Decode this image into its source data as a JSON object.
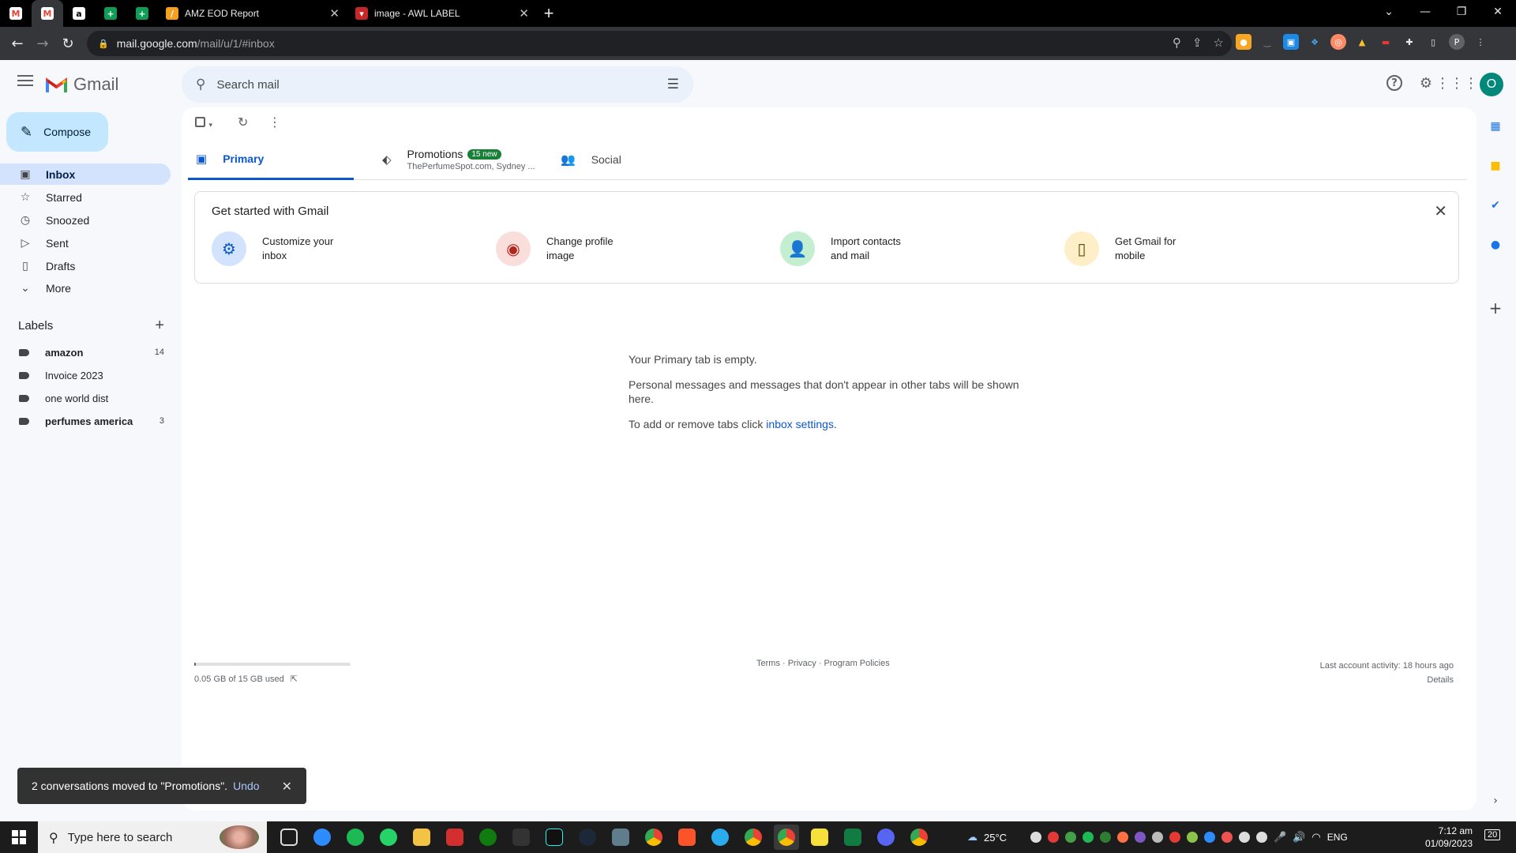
{
  "browser": {
    "tabs": [
      {
        "title": "AMZ EOD Report"
      },
      {
        "title": "image - AWL LABEL"
      }
    ],
    "url_host": "mail.google.com",
    "url_path": "/mail/u/1/#inbox",
    "profile_initial": "P"
  },
  "gmail": {
    "logo_text": "Gmail",
    "search_placeholder": "Search mail",
    "avatar_initial": "O",
    "compose_label": "Compose",
    "nav": [
      {
        "label": "Inbox",
        "icon": "inbox-icon"
      },
      {
        "label": "Starred",
        "icon": "star-icon"
      },
      {
        "label": "Snoozed",
        "icon": "clock-icon"
      },
      {
        "label": "Sent",
        "icon": "send-icon"
      },
      {
        "label": "Drafts",
        "icon": "draft-icon"
      },
      {
        "label": "More",
        "icon": "chevron-down-icon"
      }
    ],
    "labels_title": "Labels",
    "labels": [
      {
        "name": "amazon",
        "count": "14"
      },
      {
        "name": "Invoice 2023",
        "count": ""
      },
      {
        "name": "one world dist",
        "count": ""
      },
      {
        "name": "perfumes america",
        "count": "3"
      }
    ],
    "tabs": {
      "primary": "Primary",
      "promotions": "Promotions",
      "promotions_badge": "15 new",
      "promotions_senders": "ThePerfumeSpot.com, Sydney ...",
      "social": "Social"
    },
    "get_started": {
      "title": "Get started with Gmail",
      "items": [
        {
          "label": "Customize your inbox"
        },
        {
          "label": "Change profile image"
        },
        {
          "label": "Import contacts and mail"
        },
        {
          "label": "Get Gmail for mobile"
        }
      ]
    },
    "empty_state": {
      "title": "Your Primary tab is empty.",
      "body": "Personal messages and messages that don't appear in other tabs will be shown here.",
      "settings_prefix": "To add or remove tabs click ",
      "settings_link": "inbox settings",
      "settings_suffix": "."
    },
    "storage": {
      "text": "0.05 GB of 15 GB used",
      "used_fraction": 0.0033
    },
    "footer_links": "Terms · Privacy · Program Policies",
    "activity": {
      "text": "Last account activity: 18 hours ago",
      "details": "Details"
    },
    "snackbar": {
      "message": "2 conversations moved to \"Promotions\".",
      "undo": "Undo"
    }
  },
  "taskbar": {
    "search_placeholder": "Type here to search",
    "weather": "25°C",
    "language": "ENG",
    "time": "7:12 am",
    "date": "01/09/2023",
    "notifications": "20"
  }
}
